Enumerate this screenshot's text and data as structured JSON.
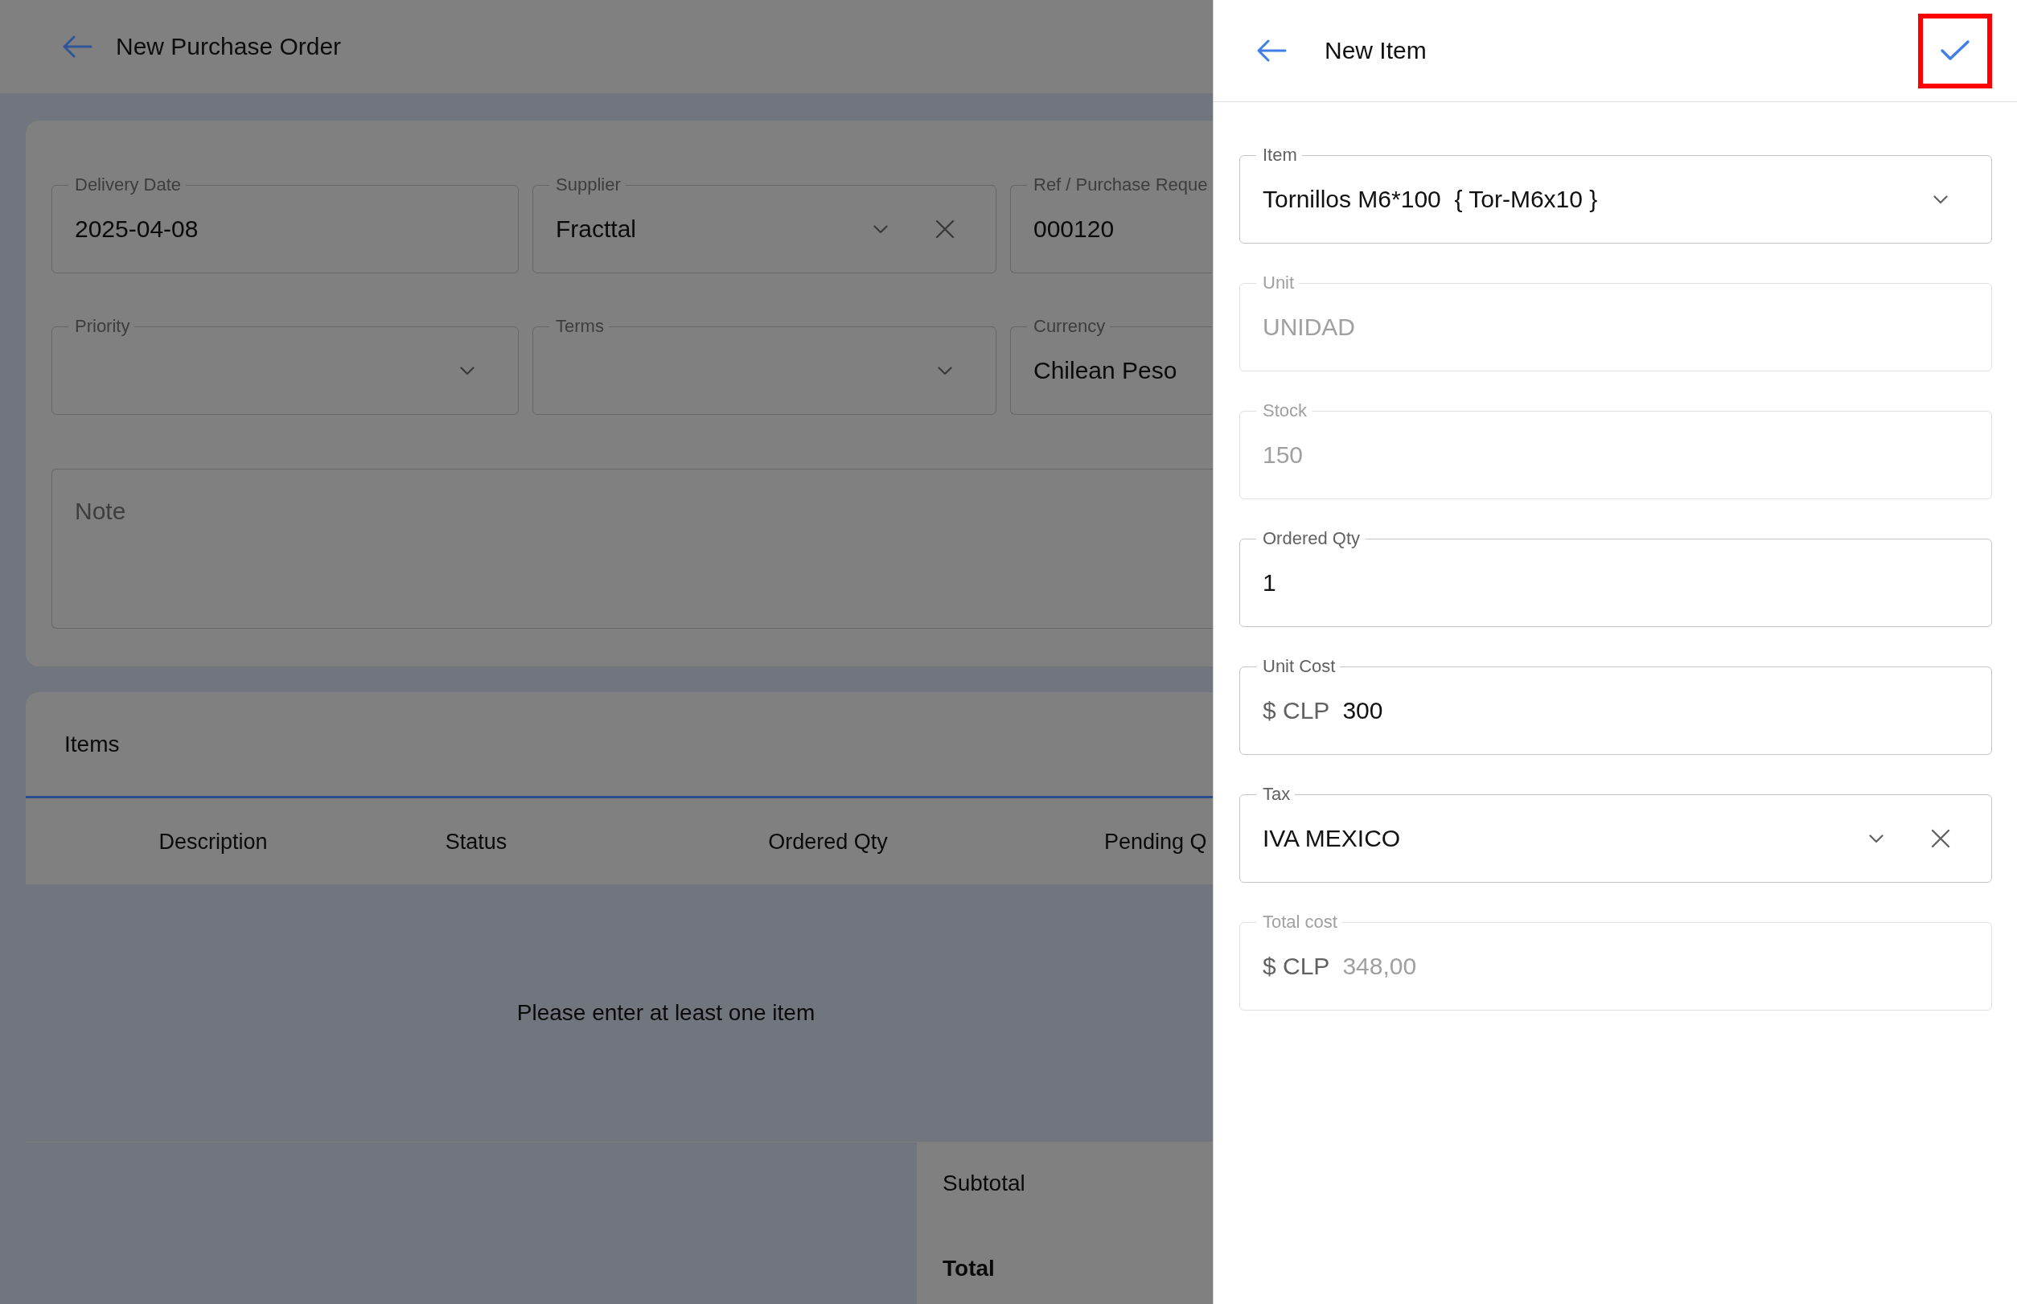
{
  "page": {
    "title": "New Purchase Order"
  },
  "order_form": {
    "fields": [
      {
        "kind": "text",
        "label": "Delivery Date",
        "value": "2025-04-08"
      },
      {
        "kind": "select",
        "label": "Supplier",
        "value": "Fracttal",
        "clearable": true
      },
      {
        "kind": "text",
        "label": "Ref / Purchase Reque",
        "value": "000120"
      },
      {
        "kind": "select",
        "label": "Priority",
        "clearable": false
      },
      {
        "kind": "select",
        "label": "Terms",
        "clearable": false
      },
      {
        "kind": "text",
        "label": "Currency",
        "value": "Chilean Peso"
      }
    ],
    "note": {
      "placeholder": "Note"
    }
  },
  "items": {
    "title": "Items",
    "table": {
      "columns": [
        "Description",
        "Status",
        "Ordered Qty",
        "Pending Q"
      ]
    },
    "empty_message": "Please enter at least one item"
  },
  "totals": [
    {
      "kind": "subtotal",
      "label": "Subtotal"
    },
    {
      "kind": "total",
      "label": "Total"
    }
  ],
  "drawer": {
    "title": "New Item",
    "confirm_button": {
      "highlighted": true
    },
    "fields": [
      {
        "kind": "select",
        "label": "Item",
        "value": "Tornillos M6*100  { Tor-M6x10 }",
        "clearable": false,
        "disabled": false
      },
      {
        "kind": "text",
        "label": "Unit",
        "value": "UNIDAD",
        "disabled": true
      },
      {
        "kind": "text",
        "label": "Stock",
        "value": "150",
        "disabled": true
      },
      {
        "kind": "text",
        "label": "Ordered Qty",
        "value": "1",
        "disabled": false
      },
      {
        "kind": "text",
        "label": "Unit Cost",
        "prefix": "$ CLP",
        "value": "300",
        "disabled": false
      },
      {
        "kind": "select",
        "label": "Tax",
        "value": "IVA MEXICO",
        "clearable": true,
        "disabled": false
      },
      {
        "kind": "text",
        "label": "Total cost",
        "prefix": "$ CLP",
        "value": "348,00",
        "disabled": true
      }
    ]
  }
}
